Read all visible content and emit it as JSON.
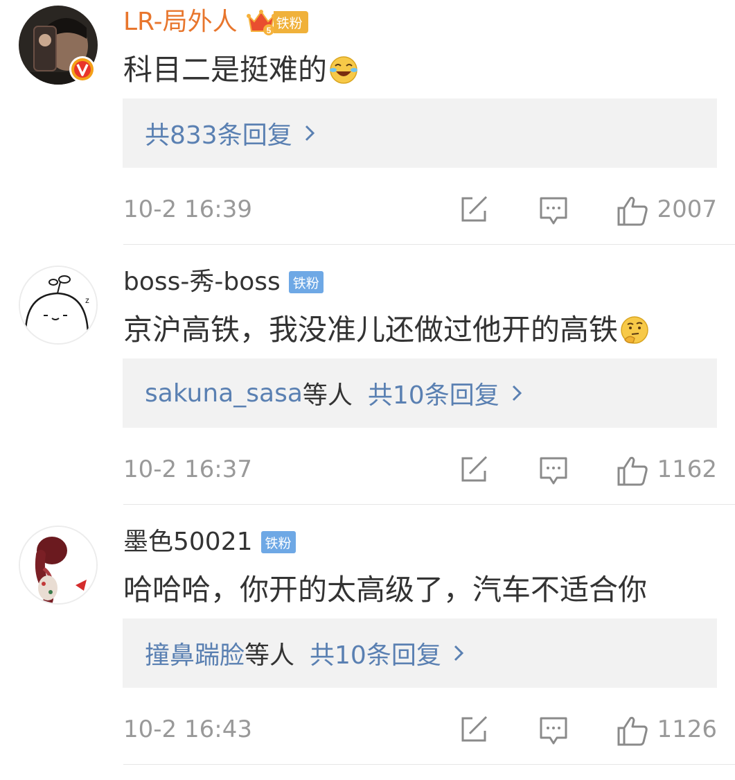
{
  "comments": [
    {
      "username": "LR-局外人",
      "fan_badge": "铁粉",
      "crown_level": "5",
      "text": "科目二是挺难的",
      "emoji": "laugh-cry-emoji",
      "reply_users": "",
      "reply_summary": "共833条回复",
      "time": "10-2 16:39",
      "likes": "2007"
    },
    {
      "username": "boss-秀-boss",
      "fan_badge": "铁粉",
      "text": "京沪高铁，我没准儿还做过他开的高铁",
      "emoji": "thinking-emoji",
      "reply_users": "sakuna_sasa",
      "reply_users_suffix": "等人",
      "reply_summary": "共10条回复",
      "time": "10-2 16:37",
      "likes": "1162"
    },
    {
      "username": "墨色50021",
      "fan_badge": "铁粉",
      "text": "哈哈哈，你开的太高级了，汽车不适合你",
      "reply_users": "撞鼻踹脸",
      "reply_users_suffix": "等人",
      "reply_summary": "共10条回复",
      "time": "10-2 16:43",
      "likes": "1126"
    }
  ],
  "colors": {
    "vip_name": "#e8762d",
    "link": "#5a80b2",
    "meta": "#999999",
    "fan_badge": "#6ea8e5"
  },
  "icons": [
    "verified-v-icon",
    "crown-icon",
    "share-icon",
    "comment-icon",
    "like-icon",
    "chevron-right-icon"
  ]
}
